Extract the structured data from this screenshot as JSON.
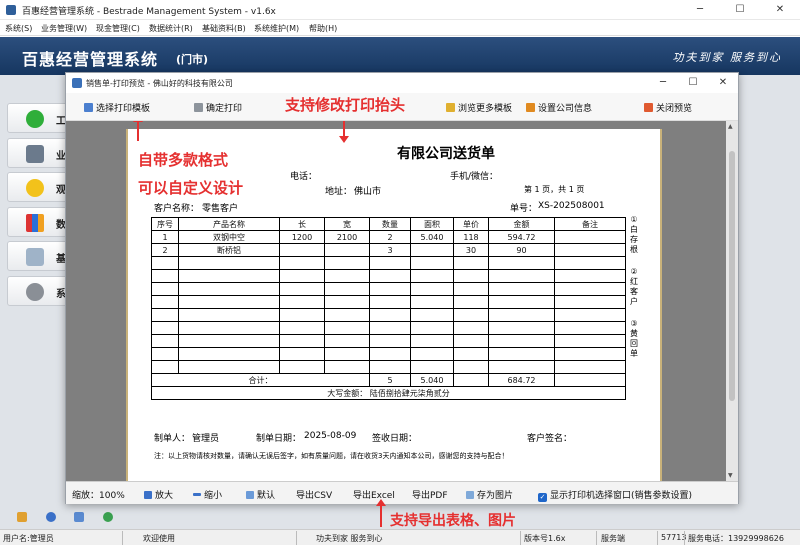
{
  "window": {
    "title": "百惠经营管理系统 - Bestrade Management System - v1.6x",
    "minimize": "─",
    "maximize": "☐",
    "close": "✕"
  },
  "menu": [
    "系统(S)",
    "业务管理(W)",
    "现金管理(C)",
    "数据统计(R)",
    "基础资料(B)",
    "系统维护(M)",
    "帮助(H)"
  ],
  "banner": {
    "title": "百惠经营管理系统",
    "subtitle": "(门市)",
    "slogan": "功夫到家 服务到心"
  },
  "nav": [
    "工",
    "业",
    "观",
    "数",
    "基",
    "系"
  ],
  "dialog": {
    "title": "销售单-打印预览 - 佛山好的科技有限公司",
    "minimize": "─",
    "maximize": "☐",
    "close": "✕",
    "toolbar": {
      "select_template": "选择打印模板",
      "confirm_print": "确定打印",
      "browse_templates": "浏览更多模板",
      "company_info": "设置公司信息",
      "close_preview": "关闭预览"
    },
    "bottom": {
      "zoom_label": "缩放：",
      "zoom_value": "100%",
      "zoom_in": "放大",
      "zoom_out": "缩小",
      "default": "默认",
      "export_csv": "导出CSV",
      "export_excel": "导出Excel",
      "export_pdf": "导出PDF",
      "save_image": "存为图片",
      "show_printer": "显示打印机选择窗口(销售参数设置)"
    }
  },
  "receipt": {
    "title": "有限公司送货单",
    "phone_label": "电话：",
    "mobile_label": "手机/微信：",
    "address_label": "地址：",
    "address": "佛山市",
    "page_info": "第 1 页，共 1 页",
    "customer_label": "客户名称：",
    "customer": "零售客户",
    "order_label": "单号：",
    "order_no": "XS-202508001",
    "headers": [
      "序号",
      "产品名称",
      "长",
      "宽",
      "数量",
      "面积",
      "单价",
      "金额",
      "备注"
    ],
    "rows": [
      [
        "1",
        "双钢中空",
        "1200",
        "2100",
        "2",
        "5.040",
        "118",
        "594.72",
        ""
      ],
      [
        "2",
        "断桥铝",
        "",
        "",
        "3",
        "",
        "30",
        "90",
        ""
      ]
    ],
    "total_label": "合计：",
    "total_qty": "5",
    "total_area": "5.040",
    "total_amount": "684.72",
    "uppercase_label": "大写金额：",
    "uppercase_amount": "陆佰捌拾肆元柒角贰分",
    "maker_label": "制单人：",
    "maker": "管理员",
    "date_label": "制单日期：",
    "date": "2025-08-09",
    "sign_date_label": "签收日期：",
    "customer_sign_label": "客户签名：",
    "note": "注：以上货物请核对数量，请确认无误后签字，如有质量问题，请在收货3天内通知本公司，感谢您的支持与配合！",
    "copies": [
      "①白存根",
      "②红客户",
      "③黄回单"
    ]
  },
  "annotations": {
    "modify_header": "支持修改打印抬头",
    "templates_line1": "自带多款格式",
    "templates_line2": "可以自定义设计",
    "export": "支持导出表格、图片"
  },
  "status": {
    "user": "用户名:管理员",
    "welcome": "欢迎使用",
    "slogan": "功夫到家 服务到心",
    "version": "版本号1.6x",
    "server": "服务端",
    "port": "57713",
    "phone": "服务电话：13929998626"
  }
}
